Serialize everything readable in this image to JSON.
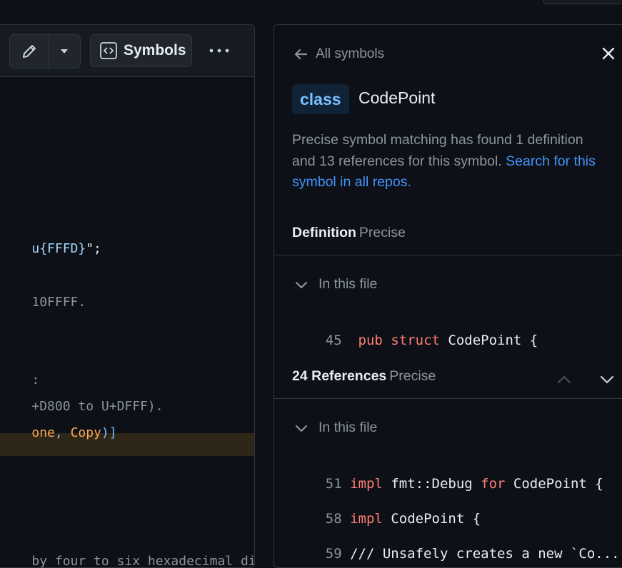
{
  "code_view": {
    "toolbar": {
      "symbols_label": "Symbols",
      "more_label": "•••"
    },
    "lines": [
      {
        "segments": [
          {
            "text": "u{FFFD}",
            "cls": "c-str"
          },
          {
            "text": "\";",
            "cls": "c-white"
          }
        ]
      },
      {
        "segments": [
          {
            "text": "10FFFF.",
            "cls": ""
          }
        ]
      },
      {
        "segments": [
          {
            "text": ":",
            "cls": ""
          }
        ]
      },
      {
        "segments": [
          {
            "text": "+D800 to U+DFFF).",
            "cls": ""
          }
        ]
      },
      {
        "segments": [
          {
            "text": "one",
            "cls": "c-org"
          },
          {
            "text": ", ",
            "cls": "c-punc"
          },
          {
            "text": "Copy",
            "cls": "c-org"
          },
          {
            "text": ")]",
            "cls": "c-punc"
          }
        ]
      },
      {
        "segments": [
          {
            "text": "by four to six hexadecimal di",
            "cls": ""
          }
        ]
      }
    ]
  },
  "symbols_panel": {
    "back_label": "All symbols",
    "kind_badge": "class",
    "symbol_name": "CodePoint",
    "description": "Precise symbol matching has found 1 definition and 13 references for this symbol.",
    "search_link": "Search for this symbol in all repos.",
    "definition": {
      "title": "Definition",
      "precision": "Precise",
      "group_label": "In this file",
      "line_number": "45",
      "code": [
        {
          "text": "pub ",
          "cls": "kw"
        },
        {
          "text": "struct ",
          "cls": "kw"
        },
        {
          "text": "CodePoint {",
          "cls": "plain"
        }
      ]
    },
    "references": {
      "title": "24 References",
      "precision": "Precise",
      "group_label": "In this file",
      "lines": [
        {
          "ln": "51",
          "code": [
            {
              "text": "impl ",
              "cls": "kw"
            },
            {
              "text": "fmt::Debug ",
              "cls": "plain"
            },
            {
              "text": "for ",
              "cls": "kw"
            },
            {
              "text": "CodePoint {",
              "cls": "plain"
            }
          ]
        },
        {
          "ln": "58",
          "code": [
            {
              "text": "impl ",
              "cls": "kw"
            },
            {
              "text": "CodePoint {",
              "cls": "plain"
            }
          ]
        },
        {
          "ln": "59",
          "code": [
            {
              "text": "/// Unsafely creates a new `Co...",
              "cls": "cmt"
            }
          ]
        }
      ]
    }
  },
  "colors": {
    "background": "#0d1117",
    "border": "#30363d",
    "link": "#4493f8",
    "keyword": "#ff7b72",
    "badge_bg": "#102236",
    "badge_text": "#79c0ff",
    "highlight": "#2e2718"
  },
  "icons": [
    "pencil-icon",
    "triangle-down-icon",
    "code-square-icon",
    "kebab-horizontal-icon",
    "arrow-left-icon",
    "close-icon",
    "chevron-down-icon",
    "chevron-up-icon"
  ]
}
